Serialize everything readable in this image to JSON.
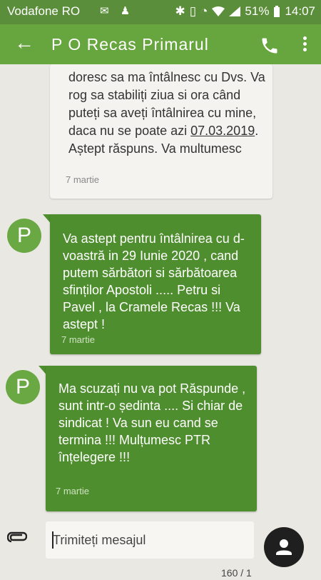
{
  "status_bar": {
    "carrier": "Vodafone RO",
    "battery": "51%",
    "time": "14:07"
  },
  "app_bar": {
    "title": "P O Recas Primarul"
  },
  "messages": [
    {
      "direction": "incoming",
      "text_before": "doresc sa ma întâlnesc cu Dvs. Va rog sa stabiliți ziua si ora când puteți sa aveți întâlnirea cu mine, daca nu se poate azi ",
      "date_link": "07.03.2019",
      "text_after": ". Aștept răspuns. Va multumesc",
      "time": "7 martie"
    },
    {
      "direction": "outgoing",
      "avatar_letter": "P",
      "text": "Va astept pentru întâlnirea cu d-voastră in 29 Iunie 2020 , cand putem sărbători si sărbătoarea sfinților Apostoli ..... Petru si Pavel , la Cramele Recas !!! Va astept !",
      "time": "7 martie"
    },
    {
      "direction": "outgoing",
      "avatar_letter": "P",
      "text": "Ma scuzați nu va pot Răspunde , sunt intr-o ședinta .... Si chiar de sindicat ! Va sun eu cand se termina !!! Mulțumesc PTR înțelegere !!!",
      "time": "7 martie"
    }
  ],
  "compose": {
    "placeholder": "Trimiteți mesajul",
    "counter": "160 / 1"
  },
  "colors": {
    "app_bar": "#67a53e",
    "status_bar": "#5b8e3a",
    "outgoing_bubble": "#4f8e2e",
    "incoming_bubble": "#f4f3ef",
    "background": "#e9e8e2"
  },
  "icons": [
    "back-arrow-icon",
    "phone-icon",
    "more-vert-icon",
    "attach-icon",
    "send-icon",
    "bluetooth-icon",
    "wifi-icon",
    "signal-icon",
    "battery-icon"
  ]
}
